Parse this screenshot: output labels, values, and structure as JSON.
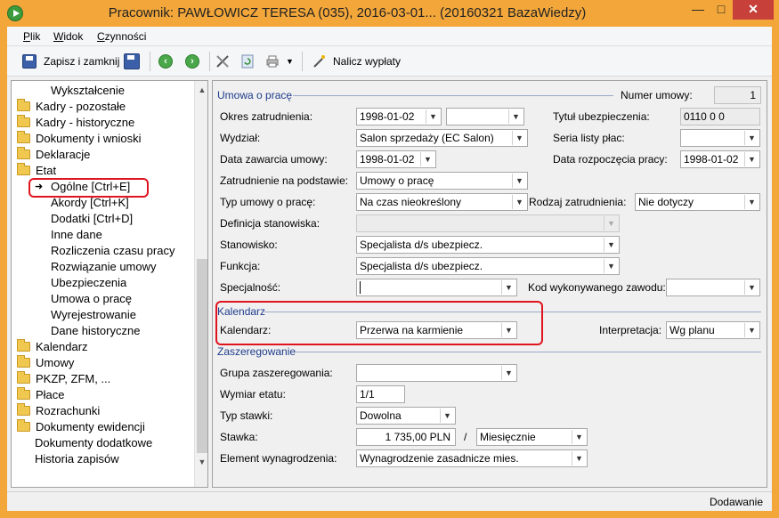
{
  "window": {
    "title": "Pracownik: PAWŁOWICZ TERESA (035), 2016-03-01... (20160321 BazaWiedzy)",
    "min": "—",
    "max": "□",
    "close": "✕"
  },
  "menu": {
    "items": [
      "Plik",
      "Widok",
      "Czynności"
    ]
  },
  "toolbar": {
    "save_close": "Zapisz i zamknij",
    "calc_pay": "Nalicz wypłaty"
  },
  "tree": {
    "items": [
      {
        "label": "Wykształcenie",
        "folder": false
      },
      {
        "label": "Kadry - pozostałe",
        "folder": true
      },
      {
        "label": "Kadry - historyczne",
        "folder": true
      },
      {
        "label": "Dokumenty i wnioski",
        "folder": true
      },
      {
        "label": "Deklaracje",
        "folder": true
      },
      {
        "label": "Etat",
        "folder": true
      },
      {
        "label": "Ogólne [Ctrl+E]",
        "folder": false,
        "selected": true
      },
      {
        "label": "Akordy [Ctrl+K]",
        "folder": false
      },
      {
        "label": "Dodatki [Ctrl+D]",
        "folder": false
      },
      {
        "label": "Inne dane",
        "folder": false
      },
      {
        "label": "Rozliczenia czasu pracy",
        "folder": false
      },
      {
        "label": "Rozwiązanie umowy",
        "folder": false
      },
      {
        "label": "Ubezpieczenia",
        "folder": false
      },
      {
        "label": "Umowa o pracę",
        "folder": false
      },
      {
        "label": "Wyrejestrowanie",
        "folder": false
      },
      {
        "label": "Dane historyczne",
        "folder": false
      },
      {
        "label": "Kalendarz",
        "folder": true
      },
      {
        "label": "Umowy",
        "folder": true
      },
      {
        "label": "PKZP, ZFM, ...",
        "folder": true
      },
      {
        "label": "Płace",
        "folder": true
      },
      {
        "label": "Rozrachunki",
        "folder": true
      },
      {
        "label": "Dokumenty ewidencji",
        "folder": true
      },
      {
        "label": "Dokumenty dodatkowe",
        "folder": false
      },
      {
        "label": "Historia zapisów",
        "folder": false
      }
    ]
  },
  "umowa": {
    "title": "Umowa o pracę",
    "nr_label": "Numer umowy:",
    "nr_value": "1",
    "okres_label": "Okres zatrudnienia:",
    "okres_od": "1998-01-02",
    "okres_do": "",
    "tytul_label": "Tytuł ubezpieczenia:",
    "tytul_value": "0110 0 0",
    "wydzial_label": "Wydział:",
    "wydzial_value": "Salon sprzedaży (EC Salon)",
    "seria_label": "Seria listy płac:",
    "seria_value": "",
    "data_zaw_label": "Data zawarcia umowy:",
    "data_zaw_value": "1998-01-02",
    "data_rozp_label": "Data rozpoczęcia pracy:",
    "data_rozp_value": "1998-01-02",
    "podstawa_label": "Zatrudnienie na podstawie:",
    "podstawa_value": "Umowy o pracę",
    "typ_label": "Typ umowy o pracę:",
    "typ_value": "Na czas nieokreślony",
    "rodzaj_label": "Rodzaj zatrudnienia:",
    "rodzaj_value": "Nie dotyczy",
    "def_label": "Definicja stanowiska:",
    "def_value": "",
    "stanowisko_label": "Stanowisko:",
    "stanowisko_value": "Specjalista d/s ubezpiecz.",
    "funkcja_label": "Funkcja:",
    "funkcja_value": "Specjalista d/s ubezpiecz.",
    "specjalnosc_label": "Specjalność:",
    "specjalnosc_value": "",
    "kod_label": "Kod wykonywanego zawodu:",
    "kod_value": ""
  },
  "kalendarz": {
    "title": "Kalendarz",
    "kal_label": "Kalendarz:",
    "kal_value": "Przerwa na karmienie",
    "interp_label": "Interpretacja:",
    "interp_value": "Wg planu"
  },
  "zaszeregowanie": {
    "title": "Zaszeregowanie",
    "grupa_label": "Grupa zaszeregowania:",
    "grupa_value": "",
    "wymiar_label": "Wymiar etatu:",
    "wymiar_value": "1/1",
    "typ_label": "Typ stawki:",
    "typ_value": "Dowolna",
    "stawka_label": "Stawka:",
    "stawka_value": "1 735,00 PLN",
    "stawka_sep": "/",
    "okres_value": "Miesięcznie",
    "element_label": "Element wynagrodzenia:",
    "element_value": "Wynagrodzenie zasadnicze mies."
  },
  "status": {
    "mode": "Dodawanie"
  },
  "colors": {
    "accent": "#f3a73a",
    "highlight": "#e0141e",
    "section": "#1e3c8c"
  }
}
